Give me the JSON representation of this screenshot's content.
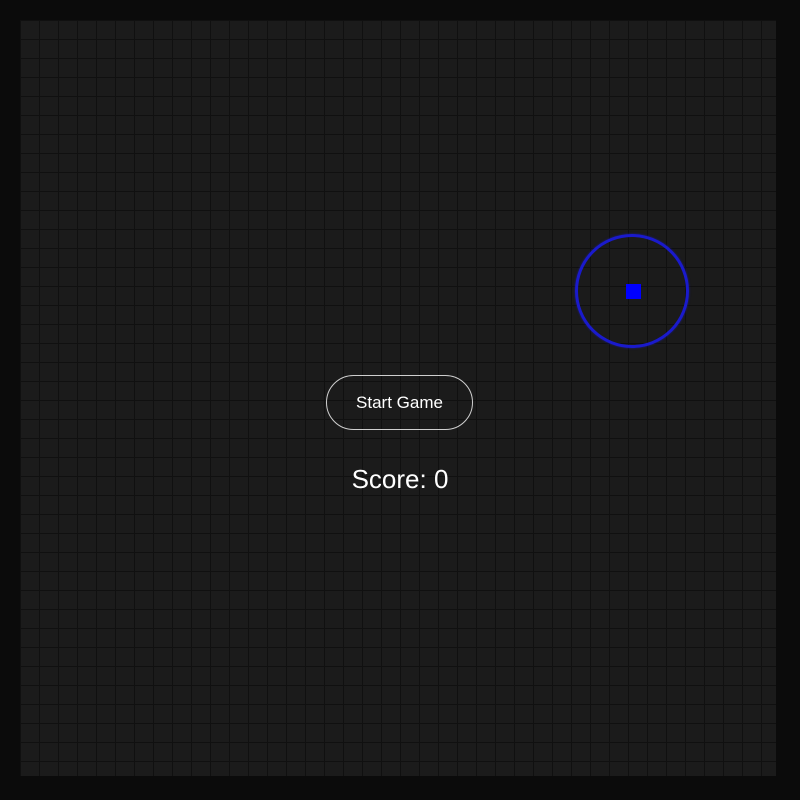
{
  "game": {
    "start_button_label": "Start Game",
    "score_text": "Score: 0",
    "colors": {
      "background": "#0b0b0b",
      "cell": "#1b1b1b",
      "grid_line": "#101010",
      "player": "#0000ff",
      "target_ring": "#1a1acc",
      "text": "#ffffff"
    }
  }
}
